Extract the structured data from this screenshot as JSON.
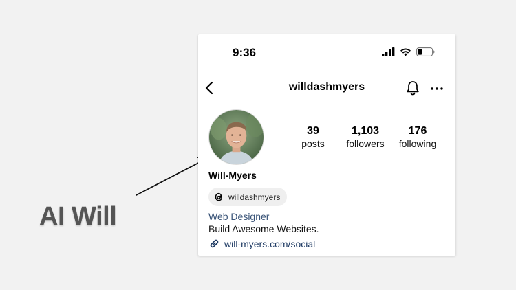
{
  "slide": {
    "label": "AI Will"
  },
  "status_bar": {
    "time": "9:36",
    "icons": [
      "signal-icon",
      "wifi-icon",
      "battery-icon"
    ]
  },
  "header": {
    "username": "willdashmyers",
    "icons": [
      "back-chevron-icon",
      "bell-icon",
      "more-dots-icon"
    ]
  },
  "profile": {
    "stats": [
      {
        "value": "39",
        "label": "posts"
      },
      {
        "value": "1,103",
        "label": "followers"
      },
      {
        "value": "176",
        "label": "following"
      }
    ],
    "display_name": "Will-Myers",
    "threads_handle": "willdashmyers",
    "category": "Web Designer",
    "bio": "Build Awesome Websites.",
    "link": "will-myers.com/social"
  },
  "colors": {
    "background": "#f2f2f2",
    "card": "#ffffff",
    "link": "#1e3a63",
    "category": "#3a5478",
    "label": "#555555"
  }
}
